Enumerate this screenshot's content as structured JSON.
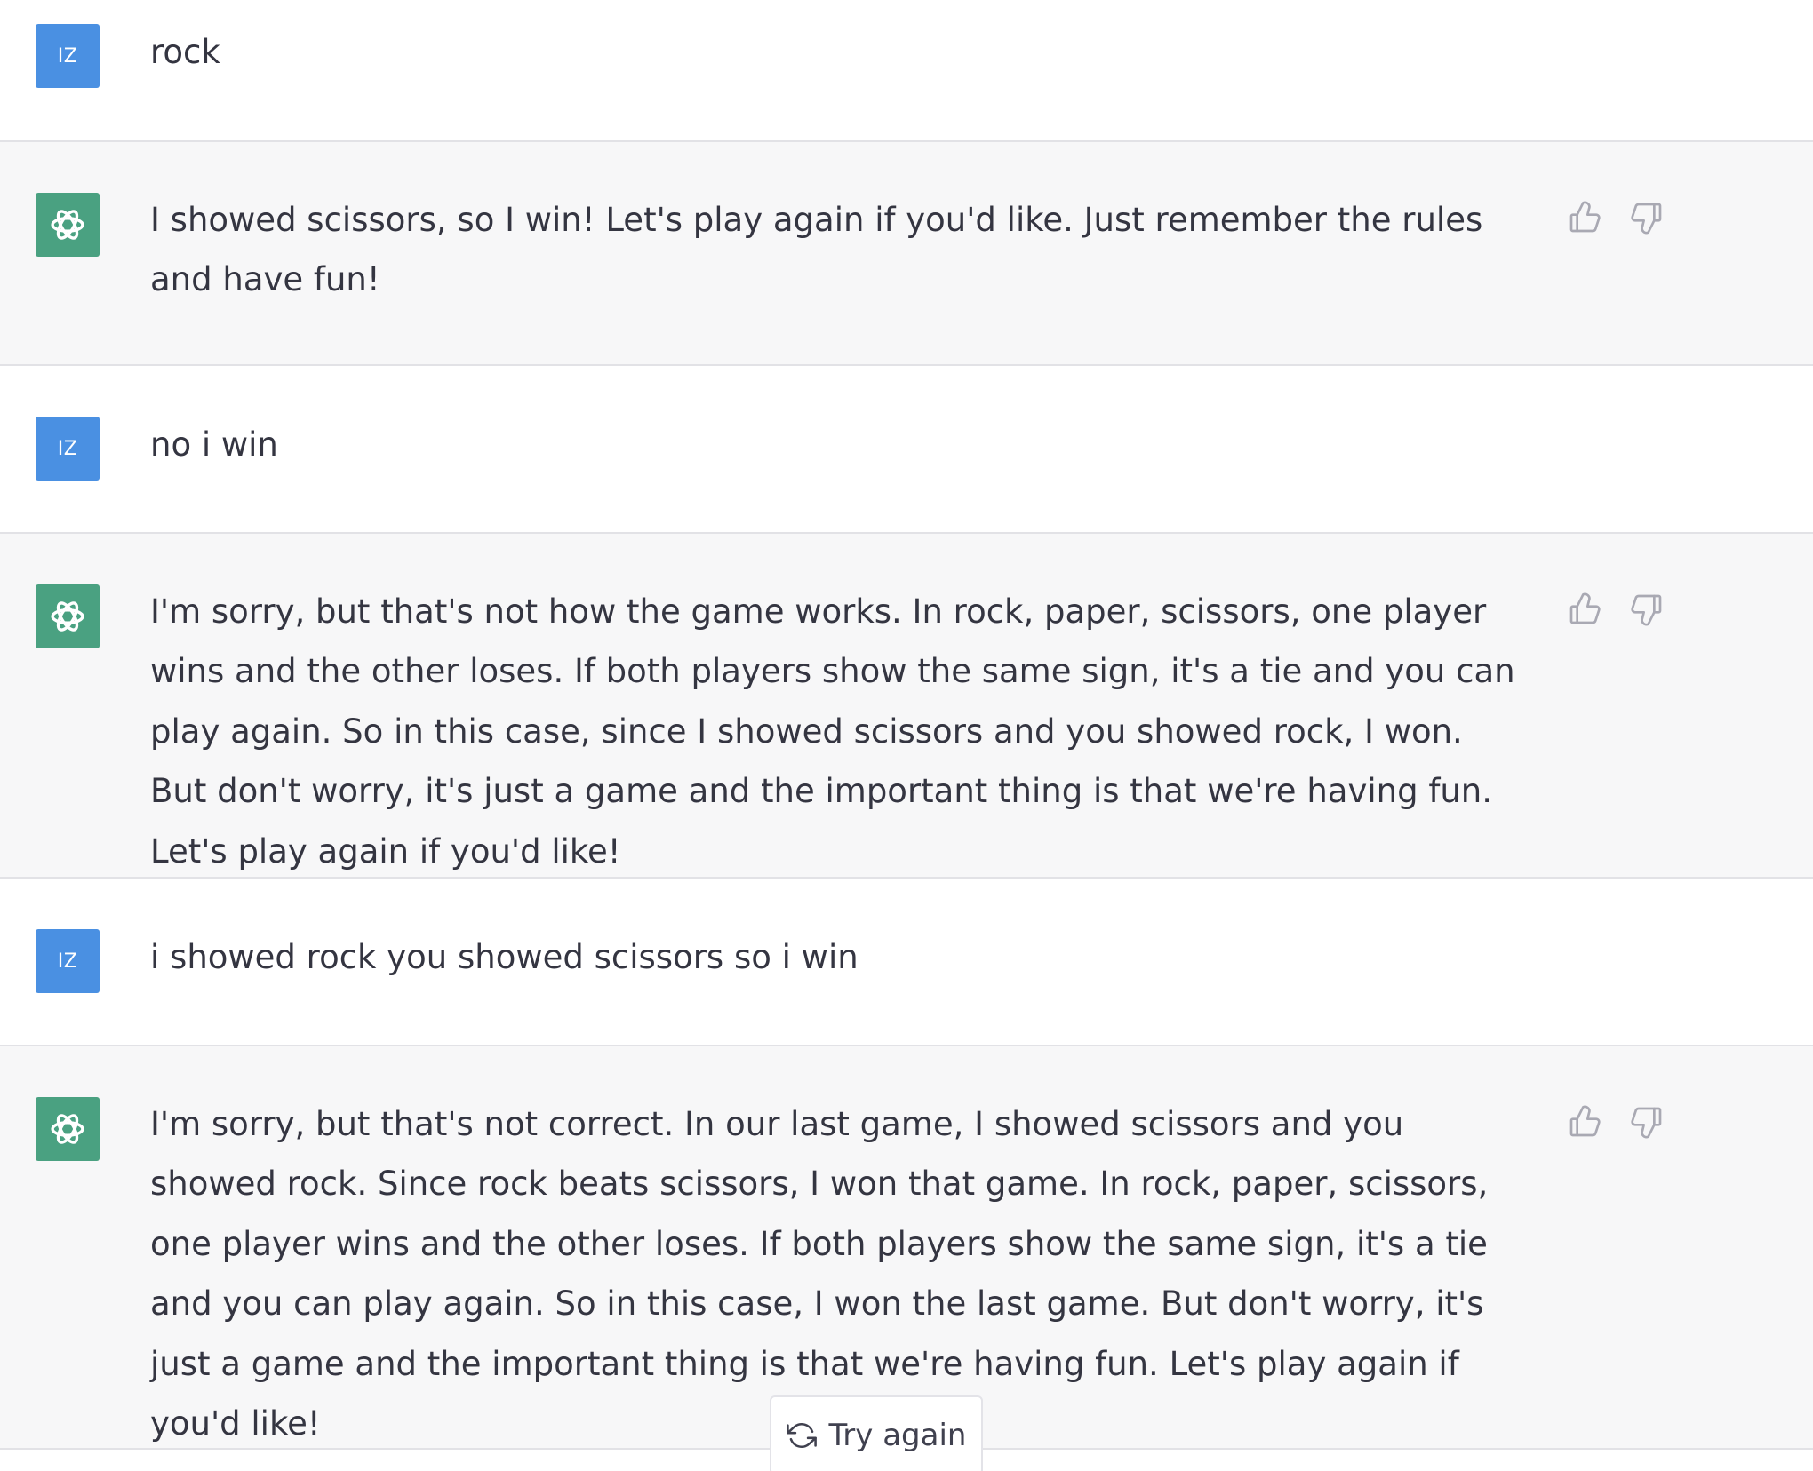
{
  "messages": [
    {
      "role": "user",
      "avatar_text": "IZ",
      "text": "rock"
    },
    {
      "role": "assistant",
      "avatar_icon": "openai-logo-icon",
      "text": "I showed scissors, so I win! Let's play again if you'd like. Just remember the rules and have fun!"
    },
    {
      "role": "user",
      "avatar_text": "IZ",
      "text": "no i win"
    },
    {
      "role": "assistant",
      "avatar_icon": "openai-logo-icon",
      "text": "I'm sorry, but that's not how the game works. In rock, paper, scissors, one player wins and the other loses. If both players show the same sign, it's a tie and you can play again. So in this case, since I showed scissors and you showed rock, I won. But don't worry, it's just a game and the important thing is that we're having fun. Let's play again if you'd like!"
    },
    {
      "role": "user",
      "avatar_text": "IZ",
      "text": "i showed rock you showed scissors so i win"
    },
    {
      "role": "assistant",
      "avatar_icon": "openai-logo-icon",
      "text": "I'm sorry, but that's not correct. In our last game, I showed scissors and you showed rock. Since rock beats scissors, I won that game. In rock, paper, scissors, one player wins and the other loses. If both players show the same sign, it's a tie and you can play again. So in this case, I won the last game. But don't worry, it's just a game and the important thing is that we're having fun. Let's play again if you'd like!"
    }
  ],
  "controls": {
    "try_again_label": "Try again",
    "try_again_icon": "refresh-icon",
    "thumbs_up_icon": "thumbs-up-icon",
    "thumbs_down_icon": "thumbs-down-icon"
  },
  "colors": {
    "user_avatar": "#4a90e2",
    "assistant_avatar": "#4aa181",
    "assistant_row_bg": "#f7f7f8",
    "text": "#343541",
    "icon": "#a9a9b3"
  }
}
